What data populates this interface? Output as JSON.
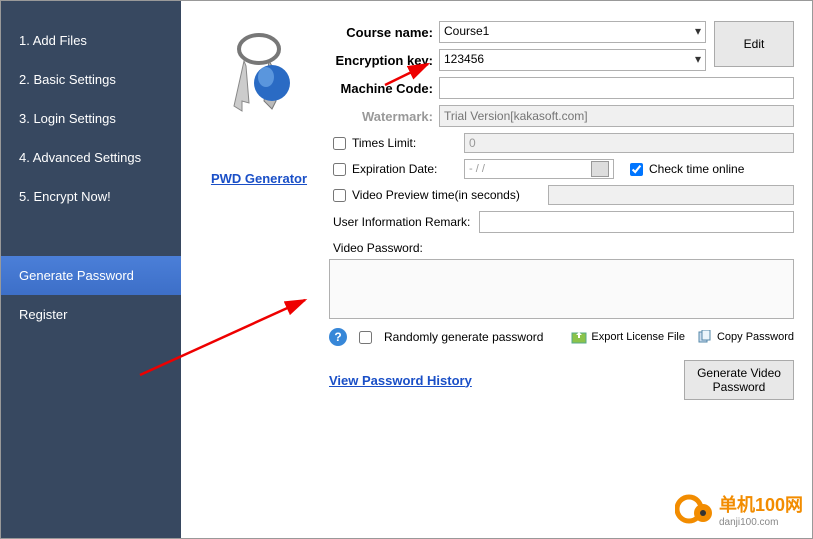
{
  "sidebar": {
    "items": [
      {
        "label": "1. Add Files"
      },
      {
        "label": "2. Basic Settings"
      },
      {
        "label": "3. Login Settings"
      },
      {
        "label": "4. Advanced Settings"
      },
      {
        "label": "5. Encrypt Now!"
      },
      {
        "label": "Generate Password"
      },
      {
        "label": "Register"
      }
    ]
  },
  "pwd_generator_link": "PWD Generator",
  "form": {
    "course_label": "Course name:",
    "course_value": "Course1",
    "enc_label": "Encryption key:",
    "enc_value": "123456",
    "machine_label": "Machine Code:",
    "machine_value": "",
    "watermark_label": "Watermark:",
    "watermark_placeholder": "Trial Version[kakasoft.com]",
    "edit_btn": "Edit",
    "times_limit_label": "Times Limit:",
    "times_limit_value": "0",
    "expiration_label": "Expiration Date:",
    "expiration_value": "- / /",
    "check_time_label": "Check time online",
    "preview_label": "Video Preview time(in seconds)",
    "preview_value": "",
    "remark_label": "User Information Remark:",
    "remark_value": "",
    "video_pwd_label": "Video Password:",
    "random_label": "Randomly generate password",
    "export_label": "Export License File",
    "copy_label": "Copy Password",
    "gen_btn": "Generate Video Password",
    "history_link": "View Password History"
  },
  "logo": {
    "brand": "单机100网",
    "domain": "danji100.com"
  }
}
